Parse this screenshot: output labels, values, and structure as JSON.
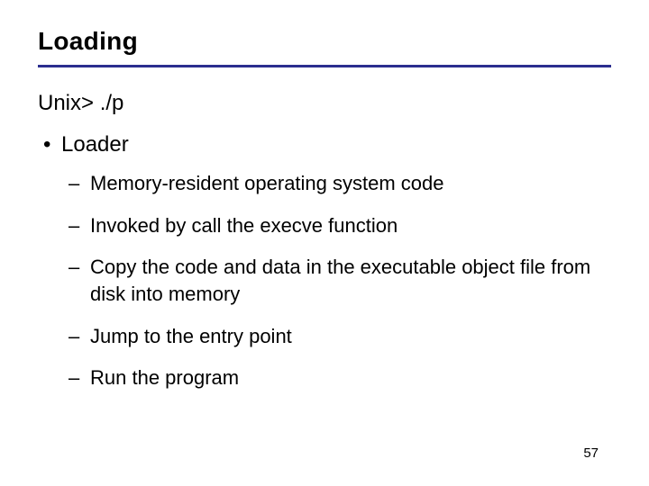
{
  "title": "Loading",
  "command": "Unix> ./p",
  "bullet": {
    "marker": "•",
    "label": "Loader"
  },
  "subitems": [
    "Memory-resident operating system code",
    "Invoked by call the execve function",
    "Copy the code and data in the executable object file from disk into memory",
    "Jump to the entry point",
    "Run the program"
  ],
  "page_number": "57"
}
